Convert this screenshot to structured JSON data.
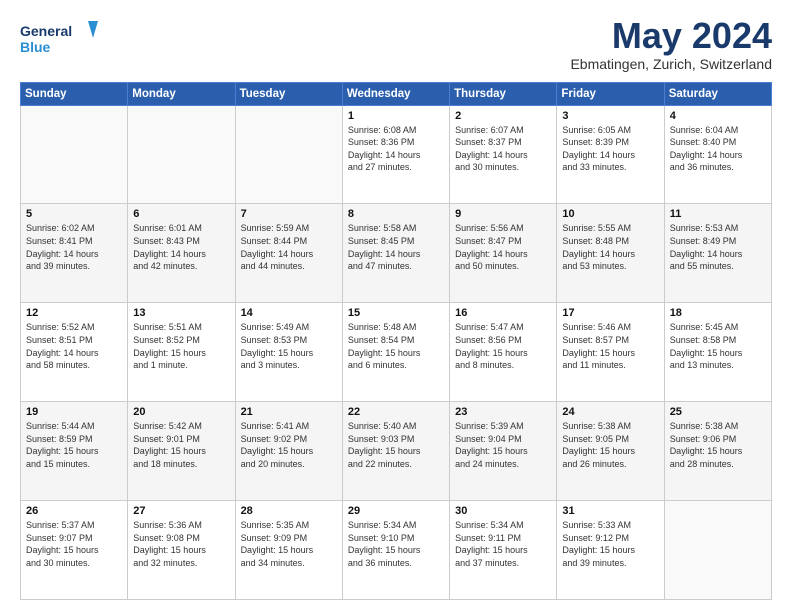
{
  "header": {
    "logo_line1": "General",
    "logo_line2": "Blue",
    "month_title": "May 2024",
    "location": "Ebmatingen, Zurich, Switzerland"
  },
  "days_of_week": [
    "Sunday",
    "Monday",
    "Tuesday",
    "Wednesday",
    "Thursday",
    "Friday",
    "Saturday"
  ],
  "weeks": [
    [
      {
        "day": "",
        "info": ""
      },
      {
        "day": "",
        "info": ""
      },
      {
        "day": "",
        "info": ""
      },
      {
        "day": "1",
        "info": "Sunrise: 6:08 AM\nSunset: 8:36 PM\nDaylight: 14 hours\nand 27 minutes."
      },
      {
        "day": "2",
        "info": "Sunrise: 6:07 AM\nSunset: 8:37 PM\nDaylight: 14 hours\nand 30 minutes."
      },
      {
        "day": "3",
        "info": "Sunrise: 6:05 AM\nSunset: 8:39 PM\nDaylight: 14 hours\nand 33 minutes."
      },
      {
        "day": "4",
        "info": "Sunrise: 6:04 AM\nSunset: 8:40 PM\nDaylight: 14 hours\nand 36 minutes."
      }
    ],
    [
      {
        "day": "5",
        "info": "Sunrise: 6:02 AM\nSunset: 8:41 PM\nDaylight: 14 hours\nand 39 minutes."
      },
      {
        "day": "6",
        "info": "Sunrise: 6:01 AM\nSunset: 8:43 PM\nDaylight: 14 hours\nand 42 minutes."
      },
      {
        "day": "7",
        "info": "Sunrise: 5:59 AM\nSunset: 8:44 PM\nDaylight: 14 hours\nand 44 minutes."
      },
      {
        "day": "8",
        "info": "Sunrise: 5:58 AM\nSunset: 8:45 PM\nDaylight: 14 hours\nand 47 minutes."
      },
      {
        "day": "9",
        "info": "Sunrise: 5:56 AM\nSunset: 8:47 PM\nDaylight: 14 hours\nand 50 minutes."
      },
      {
        "day": "10",
        "info": "Sunrise: 5:55 AM\nSunset: 8:48 PM\nDaylight: 14 hours\nand 53 minutes."
      },
      {
        "day": "11",
        "info": "Sunrise: 5:53 AM\nSunset: 8:49 PM\nDaylight: 14 hours\nand 55 minutes."
      }
    ],
    [
      {
        "day": "12",
        "info": "Sunrise: 5:52 AM\nSunset: 8:51 PM\nDaylight: 14 hours\nand 58 minutes."
      },
      {
        "day": "13",
        "info": "Sunrise: 5:51 AM\nSunset: 8:52 PM\nDaylight: 15 hours\nand 1 minute."
      },
      {
        "day": "14",
        "info": "Sunrise: 5:49 AM\nSunset: 8:53 PM\nDaylight: 15 hours\nand 3 minutes."
      },
      {
        "day": "15",
        "info": "Sunrise: 5:48 AM\nSunset: 8:54 PM\nDaylight: 15 hours\nand 6 minutes."
      },
      {
        "day": "16",
        "info": "Sunrise: 5:47 AM\nSunset: 8:56 PM\nDaylight: 15 hours\nand 8 minutes."
      },
      {
        "day": "17",
        "info": "Sunrise: 5:46 AM\nSunset: 8:57 PM\nDaylight: 15 hours\nand 11 minutes."
      },
      {
        "day": "18",
        "info": "Sunrise: 5:45 AM\nSunset: 8:58 PM\nDaylight: 15 hours\nand 13 minutes."
      }
    ],
    [
      {
        "day": "19",
        "info": "Sunrise: 5:44 AM\nSunset: 8:59 PM\nDaylight: 15 hours\nand 15 minutes."
      },
      {
        "day": "20",
        "info": "Sunrise: 5:42 AM\nSunset: 9:01 PM\nDaylight: 15 hours\nand 18 minutes."
      },
      {
        "day": "21",
        "info": "Sunrise: 5:41 AM\nSunset: 9:02 PM\nDaylight: 15 hours\nand 20 minutes."
      },
      {
        "day": "22",
        "info": "Sunrise: 5:40 AM\nSunset: 9:03 PM\nDaylight: 15 hours\nand 22 minutes."
      },
      {
        "day": "23",
        "info": "Sunrise: 5:39 AM\nSunset: 9:04 PM\nDaylight: 15 hours\nand 24 minutes."
      },
      {
        "day": "24",
        "info": "Sunrise: 5:38 AM\nSunset: 9:05 PM\nDaylight: 15 hours\nand 26 minutes."
      },
      {
        "day": "25",
        "info": "Sunrise: 5:38 AM\nSunset: 9:06 PM\nDaylight: 15 hours\nand 28 minutes."
      }
    ],
    [
      {
        "day": "26",
        "info": "Sunrise: 5:37 AM\nSunset: 9:07 PM\nDaylight: 15 hours\nand 30 minutes."
      },
      {
        "day": "27",
        "info": "Sunrise: 5:36 AM\nSunset: 9:08 PM\nDaylight: 15 hours\nand 32 minutes."
      },
      {
        "day": "28",
        "info": "Sunrise: 5:35 AM\nSunset: 9:09 PM\nDaylight: 15 hours\nand 34 minutes."
      },
      {
        "day": "29",
        "info": "Sunrise: 5:34 AM\nSunset: 9:10 PM\nDaylight: 15 hours\nand 36 minutes."
      },
      {
        "day": "30",
        "info": "Sunrise: 5:34 AM\nSunset: 9:11 PM\nDaylight: 15 hours\nand 37 minutes."
      },
      {
        "day": "31",
        "info": "Sunrise: 5:33 AM\nSunset: 9:12 PM\nDaylight: 15 hours\nand 39 minutes."
      },
      {
        "day": "",
        "info": ""
      }
    ]
  ]
}
